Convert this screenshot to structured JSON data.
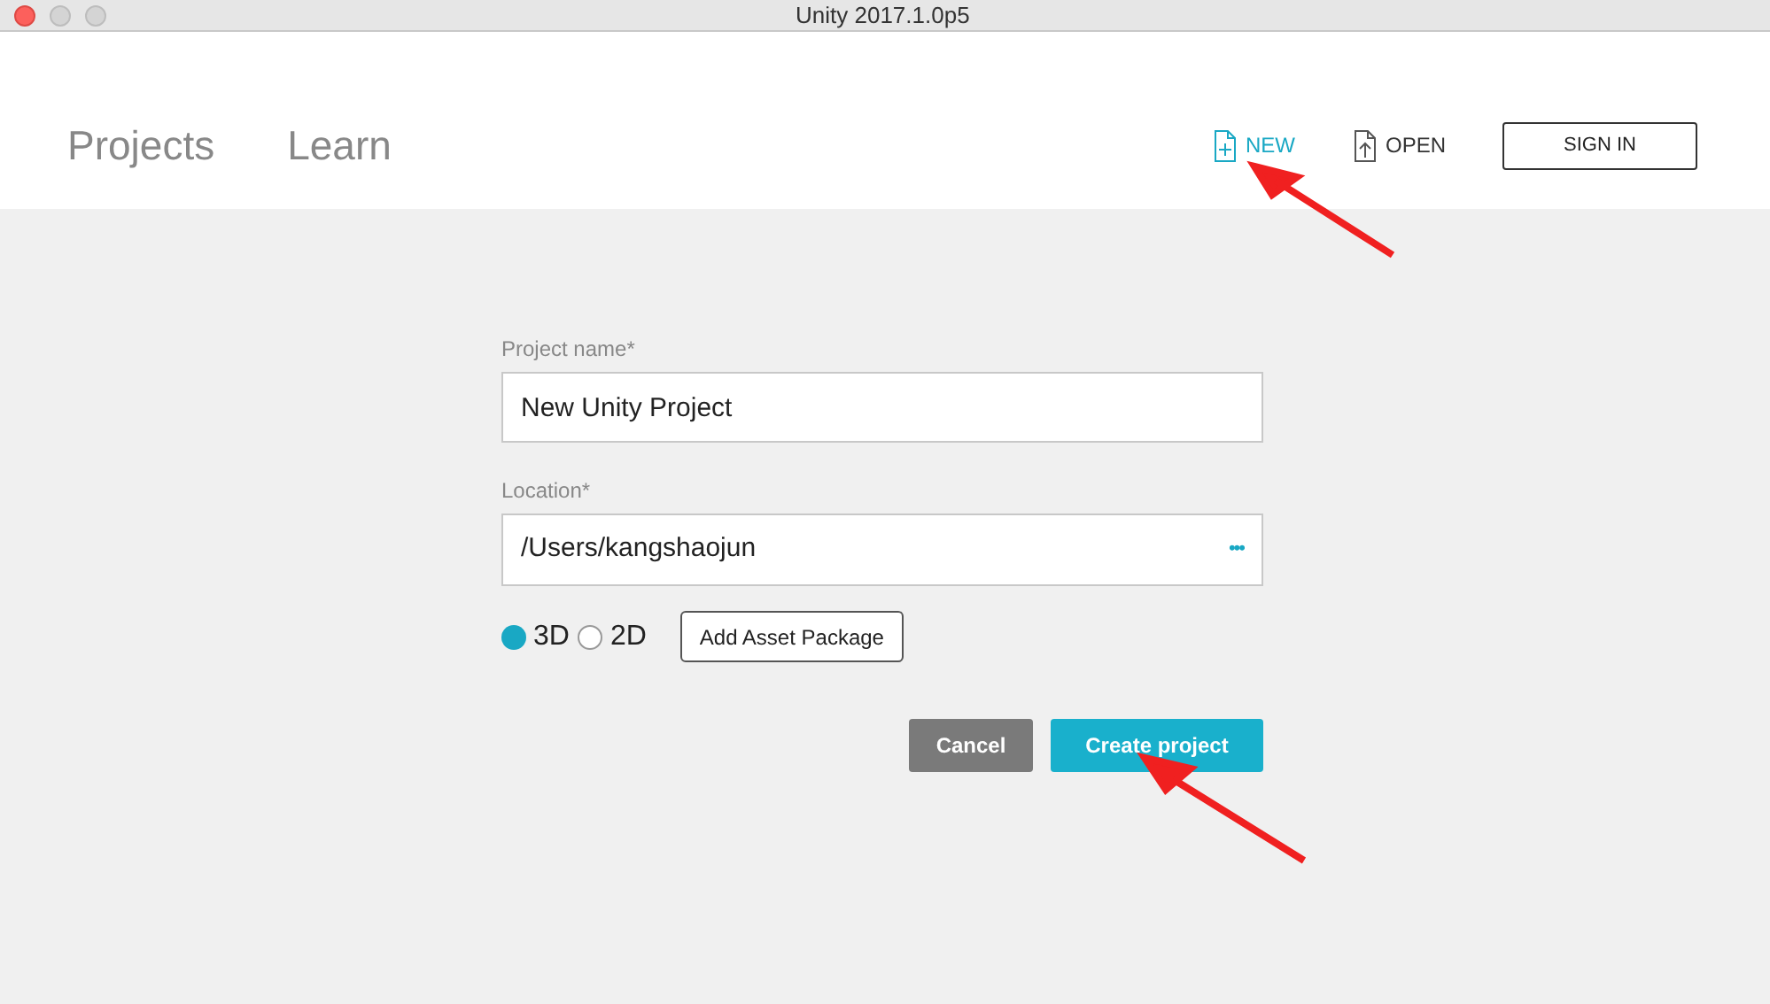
{
  "window": {
    "title": "Unity 2017.1.0p5"
  },
  "nav_tabs": [
    {
      "label": "Projects",
      "selected": false
    },
    {
      "label": "Learn",
      "selected": false
    }
  ],
  "header_actions": [
    {
      "kind": "new",
      "label": "NEW",
      "selected": true
    },
    {
      "kind": "open",
      "label": "OPEN",
      "selected": false
    },
    {
      "kind": "signin",
      "label": "SIGN IN",
      "selected": false
    }
  ],
  "form": {
    "project_name": {
      "label": "Project name*",
      "value": "New Unity Project"
    },
    "location": {
      "label": "Location*",
      "value": "/Users/kangshaojun",
      "browse": "•••"
    },
    "modes": [
      {
        "label": "3D",
        "selected": true
      },
      {
        "label": "2D",
        "selected": false
      }
    ],
    "asset_button": "Add Asset Package",
    "buttons": [
      {
        "kind": "cancel",
        "label": "Cancel"
      },
      {
        "kind": "create",
        "label": "Create project"
      }
    ]
  },
  "annotations": [
    {
      "kind": "arrow"
    },
    {
      "kind": "arrow"
    }
  ]
}
